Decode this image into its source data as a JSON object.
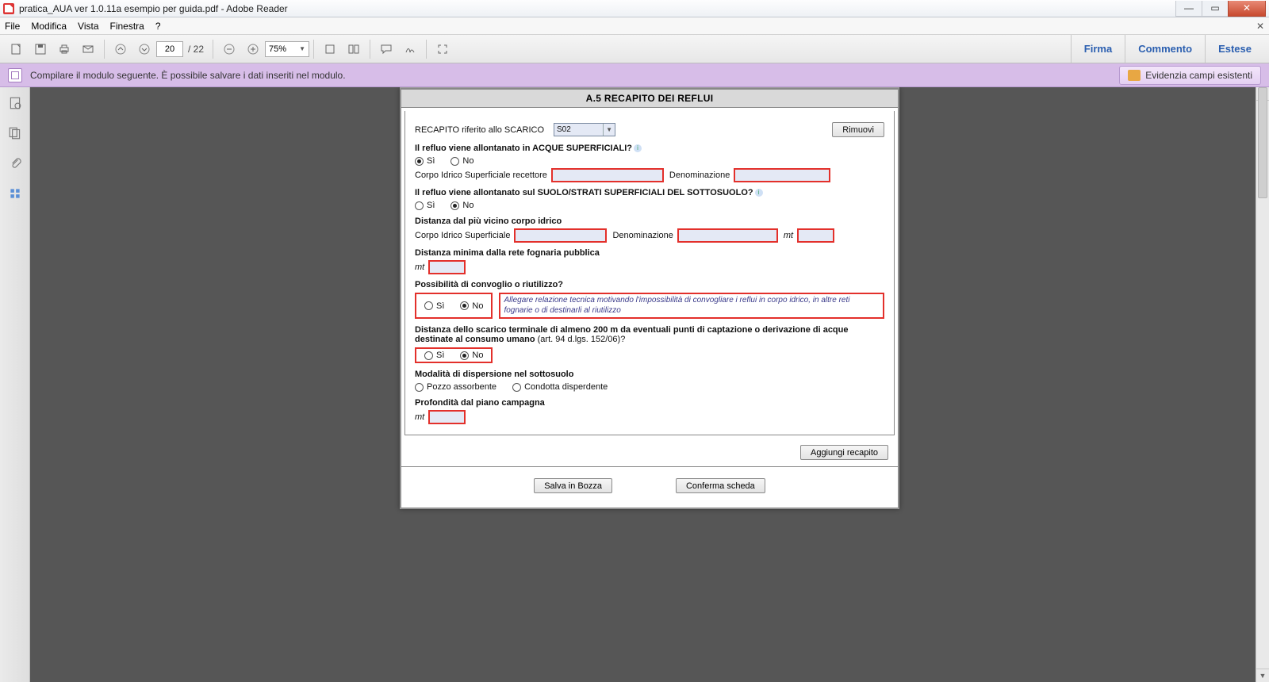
{
  "window": {
    "title": "pratica_AUA ver 1.0.11a esempio per guida.pdf - Adobe Reader"
  },
  "menu": {
    "file": "File",
    "modifica": "Modifica",
    "vista": "Vista",
    "finestra": "Finestra",
    "help": "?"
  },
  "toolbar": {
    "current_page": "20",
    "page_count": "/ 22",
    "zoom": "75%"
  },
  "right_panel": {
    "firma": "Firma",
    "commento": "Commento",
    "estese": "Estese"
  },
  "infobar": {
    "message": "Compilare il modulo seguente. È possibile salvare i dati inseriti nel modulo.",
    "highlight_button": "Evidenzia campi esistenti"
  },
  "form": {
    "section_title": "A.5  RECAPITO DEI REFLUI",
    "recapito_label": "RECAPITO riferito allo SCARICO",
    "recapito_value": "S02",
    "rimuovi": "Rimuovi",
    "q1": "Il refluo viene allontanato in ACQUE SUPERFICIALI?",
    "si": "Sì",
    "no": "No",
    "corpo_idrico_recettore": "Corpo Idrico Superficiale recettore",
    "denominazione": "Denominazione",
    "q2": "Il refluo viene allontanato sul SUOLO/STRATI SUPERFICIALI DEL SOTTOSUOLO?",
    "dist_corpo_idrico": "Distanza dal più vicino corpo idrico",
    "corpo_idrico_superficiale": "Corpo Idrico Superficiale",
    "mt": "mt",
    "dist_fognaria": "Distanza minima dalla rete fognaria pubblica",
    "q3": "Possibilità di convoglio o riutilizzo?",
    "note": "Allegare relazione tecnica motivando l'impossibilità di convogliare i reflui in corpo idrico, in altre reti fognarie o di destinarli al riutilizzo",
    "q4a": "Distanza dello scarico terminale di almeno 200 m da eventuali punti di captazione o derivazione di acque destinate al consumo umano ",
    "q4b": "(art. 94 d.lgs. 152/06)?",
    "modalita": "Modalità di dispersione nel sottosuolo",
    "pozzo": "Pozzo assorbente",
    "condotta": "Condotta disperdente",
    "profondita": "Profondità dal piano campagna",
    "aggiungi": "Aggiungi recapito",
    "salva": "Salva in Bozza",
    "conferma": "Conferma scheda"
  }
}
